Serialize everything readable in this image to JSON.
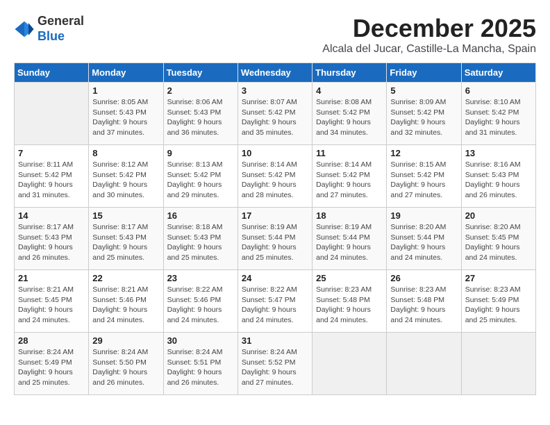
{
  "header": {
    "logo_line1": "General",
    "logo_line2": "Blue",
    "month": "December 2025",
    "location": "Alcala del Jucar, Castille-La Mancha, Spain"
  },
  "days_of_week": [
    "Sunday",
    "Monday",
    "Tuesday",
    "Wednesday",
    "Thursday",
    "Friday",
    "Saturday"
  ],
  "weeks": [
    [
      {
        "num": "",
        "info": ""
      },
      {
        "num": "1",
        "info": "Sunrise: 8:05 AM\nSunset: 5:43 PM\nDaylight: 9 hours\nand 37 minutes."
      },
      {
        "num": "2",
        "info": "Sunrise: 8:06 AM\nSunset: 5:43 PM\nDaylight: 9 hours\nand 36 minutes."
      },
      {
        "num": "3",
        "info": "Sunrise: 8:07 AM\nSunset: 5:42 PM\nDaylight: 9 hours\nand 35 minutes."
      },
      {
        "num": "4",
        "info": "Sunrise: 8:08 AM\nSunset: 5:42 PM\nDaylight: 9 hours\nand 34 minutes."
      },
      {
        "num": "5",
        "info": "Sunrise: 8:09 AM\nSunset: 5:42 PM\nDaylight: 9 hours\nand 32 minutes."
      },
      {
        "num": "6",
        "info": "Sunrise: 8:10 AM\nSunset: 5:42 PM\nDaylight: 9 hours\nand 31 minutes."
      }
    ],
    [
      {
        "num": "7",
        "info": "Sunrise: 8:11 AM\nSunset: 5:42 PM\nDaylight: 9 hours\nand 31 minutes."
      },
      {
        "num": "8",
        "info": "Sunrise: 8:12 AM\nSunset: 5:42 PM\nDaylight: 9 hours\nand 30 minutes."
      },
      {
        "num": "9",
        "info": "Sunrise: 8:13 AM\nSunset: 5:42 PM\nDaylight: 9 hours\nand 29 minutes."
      },
      {
        "num": "10",
        "info": "Sunrise: 8:14 AM\nSunset: 5:42 PM\nDaylight: 9 hours\nand 28 minutes."
      },
      {
        "num": "11",
        "info": "Sunrise: 8:14 AM\nSunset: 5:42 PM\nDaylight: 9 hours\nand 27 minutes."
      },
      {
        "num": "12",
        "info": "Sunrise: 8:15 AM\nSunset: 5:42 PM\nDaylight: 9 hours\nand 27 minutes."
      },
      {
        "num": "13",
        "info": "Sunrise: 8:16 AM\nSunset: 5:43 PM\nDaylight: 9 hours\nand 26 minutes."
      }
    ],
    [
      {
        "num": "14",
        "info": "Sunrise: 8:17 AM\nSunset: 5:43 PM\nDaylight: 9 hours\nand 26 minutes."
      },
      {
        "num": "15",
        "info": "Sunrise: 8:17 AM\nSunset: 5:43 PM\nDaylight: 9 hours\nand 25 minutes."
      },
      {
        "num": "16",
        "info": "Sunrise: 8:18 AM\nSunset: 5:43 PM\nDaylight: 9 hours\nand 25 minutes."
      },
      {
        "num": "17",
        "info": "Sunrise: 8:19 AM\nSunset: 5:44 PM\nDaylight: 9 hours\nand 25 minutes."
      },
      {
        "num": "18",
        "info": "Sunrise: 8:19 AM\nSunset: 5:44 PM\nDaylight: 9 hours\nand 24 minutes."
      },
      {
        "num": "19",
        "info": "Sunrise: 8:20 AM\nSunset: 5:44 PM\nDaylight: 9 hours\nand 24 minutes."
      },
      {
        "num": "20",
        "info": "Sunrise: 8:20 AM\nSunset: 5:45 PM\nDaylight: 9 hours\nand 24 minutes."
      }
    ],
    [
      {
        "num": "21",
        "info": "Sunrise: 8:21 AM\nSunset: 5:45 PM\nDaylight: 9 hours\nand 24 minutes."
      },
      {
        "num": "22",
        "info": "Sunrise: 8:21 AM\nSunset: 5:46 PM\nDaylight: 9 hours\nand 24 minutes."
      },
      {
        "num": "23",
        "info": "Sunrise: 8:22 AM\nSunset: 5:46 PM\nDaylight: 9 hours\nand 24 minutes."
      },
      {
        "num": "24",
        "info": "Sunrise: 8:22 AM\nSunset: 5:47 PM\nDaylight: 9 hours\nand 24 minutes."
      },
      {
        "num": "25",
        "info": "Sunrise: 8:23 AM\nSunset: 5:48 PM\nDaylight: 9 hours\nand 24 minutes."
      },
      {
        "num": "26",
        "info": "Sunrise: 8:23 AM\nSunset: 5:48 PM\nDaylight: 9 hours\nand 24 minutes."
      },
      {
        "num": "27",
        "info": "Sunrise: 8:23 AM\nSunset: 5:49 PM\nDaylight: 9 hours\nand 25 minutes."
      }
    ],
    [
      {
        "num": "28",
        "info": "Sunrise: 8:24 AM\nSunset: 5:49 PM\nDaylight: 9 hours\nand 25 minutes."
      },
      {
        "num": "29",
        "info": "Sunrise: 8:24 AM\nSunset: 5:50 PM\nDaylight: 9 hours\nand 26 minutes."
      },
      {
        "num": "30",
        "info": "Sunrise: 8:24 AM\nSunset: 5:51 PM\nDaylight: 9 hours\nand 26 minutes."
      },
      {
        "num": "31",
        "info": "Sunrise: 8:24 AM\nSunset: 5:52 PM\nDaylight: 9 hours\nand 27 minutes."
      },
      {
        "num": "",
        "info": ""
      },
      {
        "num": "",
        "info": ""
      },
      {
        "num": "",
        "info": ""
      }
    ]
  ]
}
